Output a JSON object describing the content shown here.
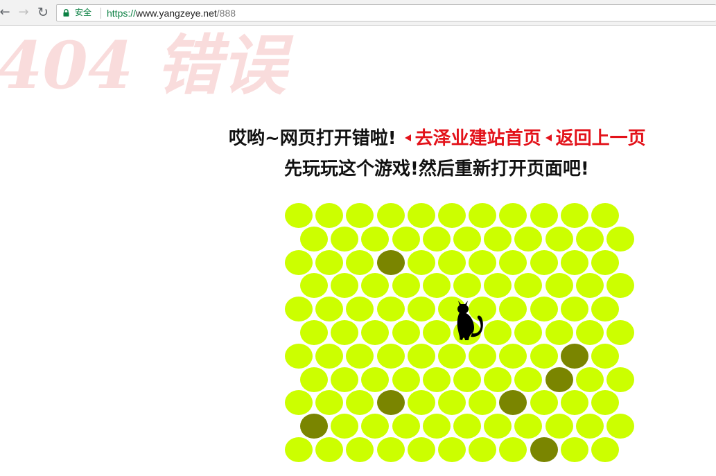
{
  "browser": {
    "security_label": "安全",
    "url_scheme": "https://",
    "url_host": "www.yangzeye.net",
    "url_path": "/888"
  },
  "page": {
    "watermark": "404 错误",
    "headline": "哎哟~网页打开错啦!",
    "home_link": "去泽业建站首页",
    "back_link": "返回上一页",
    "subline": "先玩玩这个游戏!然后重新打开页面吧!"
  },
  "game": {
    "rows": 11,
    "cols": 11,
    "colors": {
      "free": "#ccff00",
      "wall": "#7a8500",
      "cat": "#000000"
    },
    "walls": [
      [
        2,
        3
      ],
      [
        6,
        9
      ],
      [
        7,
        8
      ],
      [
        8,
        3
      ],
      [
        8,
        7
      ],
      [
        9,
        0
      ],
      [
        10,
        8
      ]
    ],
    "cat_cell": [
      4,
      5
    ]
  }
}
